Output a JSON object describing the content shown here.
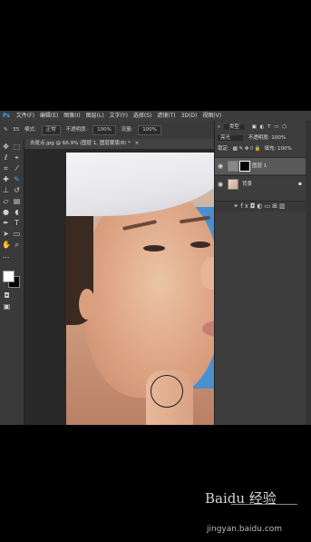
{
  "app": {
    "logo": "Ps"
  },
  "menu": [
    "文件(F)",
    "编辑(E)",
    "图像(I)",
    "图层(L)",
    "文字(Y)",
    "选择(S)",
    "滤镜(T)",
    "3D(D)",
    "视图(V)"
  ],
  "options": {
    "brush_size": "55",
    "mode_label": "模式:",
    "mode_value": "正常",
    "opacity_label": "不透明度:",
    "opacity_value": "100%",
    "flow_label": "流量:",
    "flow_value": "100%"
  },
  "document_tab": {
    "title": "去斑点.jpg @ 66.9% (图层 1, 图层蒙版/8) *",
    "close": "×"
  },
  "tools": [
    "move-icon",
    "marquee-icon",
    "lasso-icon",
    "quick-select-icon",
    "crop-icon",
    "eyedropper-icon",
    "healing-icon",
    "brush-icon",
    "stamp-icon",
    "history-brush-icon",
    "eraser-icon",
    "gradient-icon",
    "blur-icon",
    "dodge-icon",
    "pen-icon",
    "type-icon",
    "path-select-icon",
    "shape-icon",
    "hand-icon",
    "zoom-icon",
    "more-icon"
  ],
  "layers_panel": {
    "filter_kind": "类型",
    "blend_mode": "亮光",
    "opacity_label": "不透明度:",
    "opacity_value": "100%",
    "lock_label": "锁定:",
    "fill_label": "填充:",
    "fill_value": "100%",
    "layers": [
      {
        "name": "图层 1",
        "selected": true,
        "has_mask": true
      },
      {
        "name": "背景",
        "selected": false,
        "has_mask": false
      }
    ]
  },
  "watermark": {
    "logo_text": "Baidu 经验",
    "url": "jingyan.baidu.com"
  },
  "colors": {
    "accent": "#31a8ff",
    "background": "#535353",
    "panel": "#3d3d3d",
    "sky": "#4a8fcf"
  }
}
